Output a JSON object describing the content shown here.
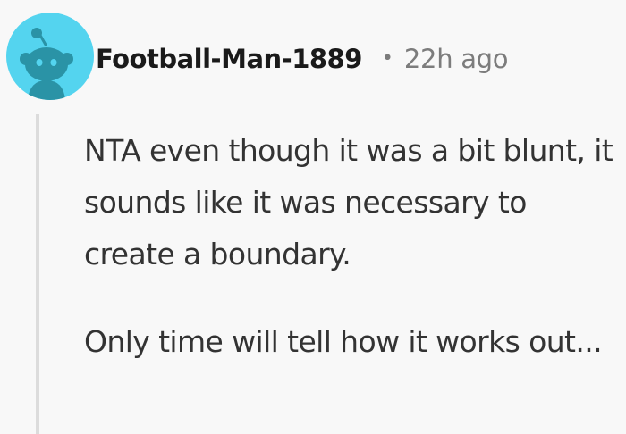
{
  "comment": {
    "author": "Football-Man-1889",
    "separator": "•",
    "timestamp": "22h ago",
    "paragraphs": [
      "NTA even though it was a bit blunt, it sounds like it was necessary to create a boundary.",
      "Only time will tell how it works out..."
    ]
  },
  "avatar": {
    "icon": "snoo-avatar-icon",
    "background_color": "#54d4ef",
    "figure_color": "#2a93a6"
  },
  "colors": {
    "background": "#f8f8f8",
    "author_text": "#1a1a1a",
    "meta_text": "#7c7c7c",
    "body_text": "#333333",
    "thread_line": "#dcdcdc"
  }
}
